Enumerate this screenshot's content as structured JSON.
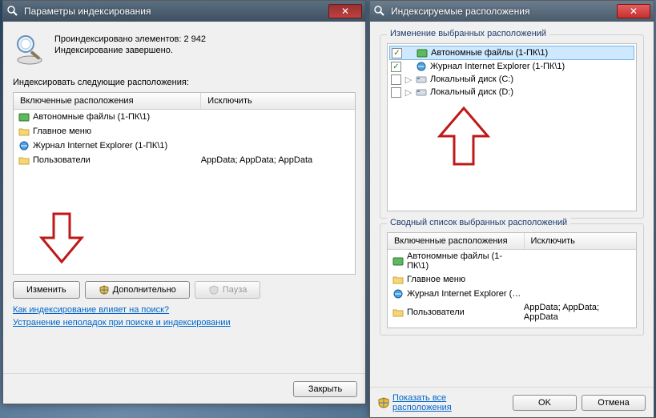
{
  "dialog1": {
    "title": "Параметры индексирования",
    "status_line1": "Проиндексировано элементов: 2 942",
    "status_line2": "Индексирование завершено.",
    "locations_label": "Индексировать следующие расположения:",
    "col_included": "Включенные расположения",
    "col_exclude": "Исключить",
    "rows": [
      {
        "name": "Автономные файлы (1-ПК\\1)",
        "exclude": ""
      },
      {
        "name": "Главное меню",
        "exclude": ""
      },
      {
        "name": "Журнал Internet Explorer (1-ПК\\1)",
        "exclude": ""
      },
      {
        "name": "Пользователи",
        "exclude": "AppData; AppData; AppData"
      }
    ],
    "btn_modify": "Изменить",
    "btn_advanced": "Дополнительно",
    "btn_pause": "Пауза",
    "link1": "Как индексирование влияет на поиск?",
    "link2": "Устранение неполадок при поиске и индексировании",
    "btn_close": "Закрыть"
  },
  "dialog2": {
    "title": "Индексируемые расположения",
    "group1_title": "Изменение выбранных расположений",
    "tree": [
      {
        "checked": true,
        "expandable": false,
        "label": "Автономные файлы (1-ПК\\1)",
        "icon": "offline"
      },
      {
        "checked": true,
        "expandable": false,
        "label": "Журнал Internet Explorer (1-ПК\\1)",
        "icon": "ie"
      },
      {
        "checked": false,
        "expandable": true,
        "label": "Локальный диск (C:)",
        "icon": "disk"
      },
      {
        "checked": false,
        "expandable": true,
        "label": "Локальный диск (D:)",
        "icon": "disk"
      }
    ],
    "group2_title": "Сводный список выбранных расположений",
    "col_included": "Включенные расположения",
    "col_exclude": "Исключить",
    "rows": [
      {
        "name": "Автономные файлы (1-ПК\\1)",
        "exclude": ""
      },
      {
        "name": "Главное меню",
        "exclude": ""
      },
      {
        "name": "Журнал Internet Explorer (…",
        "exclude": ""
      },
      {
        "name": "Пользователи",
        "exclude": "AppData; AppData; AppData"
      }
    ],
    "footer_link": "Показать все расположения",
    "btn_ok": "OK",
    "btn_cancel": "Отмена"
  }
}
